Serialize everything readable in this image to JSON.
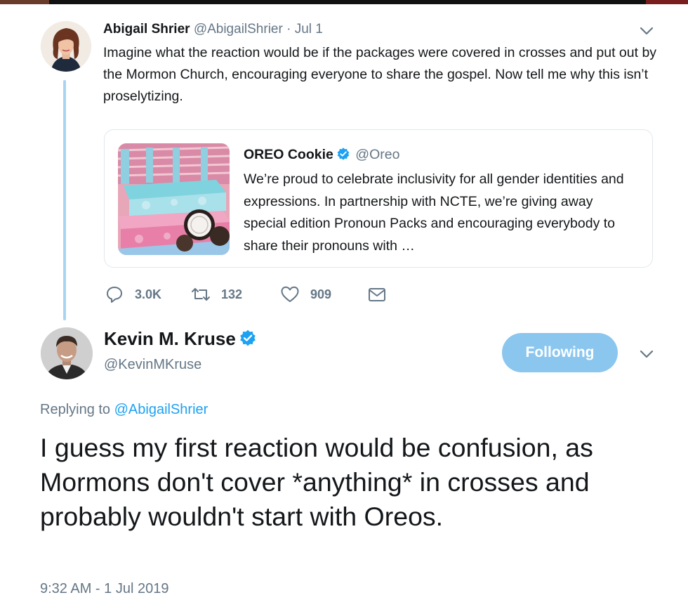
{
  "parent_tweet": {
    "author_name": "Abigail Shrier",
    "author_handle": "@AbigailShrier",
    "separator": "·",
    "date": "Jul 1",
    "text": "Imagine what the reaction would be if the packages were covered in crosses and put out by the Mormon Church, encouraging everyone to share the gospel. Now tell me why this isn’t proselytizing.",
    "avatar_icon": "woman-portrait-avatar",
    "menu_icon": "chevron-down-icon",
    "actions": {
      "replies": "3.0K",
      "retweets": "132",
      "likes": "909"
    }
  },
  "quoted_tweet": {
    "author_name": "OREO Cookie",
    "author_handle": "@Oreo",
    "verified": true,
    "text": "We’re proud to celebrate inclusivity for all gender identities and expressions. In partnership with NCTE, we’re giving away special edition Pronoun Packs and encouraging everybody to share their pronouns with …",
    "image_icon": "oreo-pronoun-packs-photo"
  },
  "main_tweet": {
    "author_name": "Kevin M. Kruse",
    "author_handle": "@KevinMKruse",
    "verified": true,
    "follow_label": "Following",
    "replying_prefix": "Replying to",
    "replying_to": "@AbigailShrier",
    "text": "I guess my first reaction would be confusion, as Mormons don't cover *anything* in crosses and probably wouldn't start with Oreos.",
    "timestamp": "9:32 AM - 1 Jul 2019",
    "avatar_icon": "man-portrait-avatar",
    "menu_icon": "chevron-down-icon"
  },
  "colors": {
    "link_blue": "#1da1f2",
    "follow_button": "#8bc6ef",
    "thread_line": "#a8d4f2",
    "secondary_text": "#657786",
    "primary_text": "#14171a",
    "verified": "#1da1f2"
  }
}
